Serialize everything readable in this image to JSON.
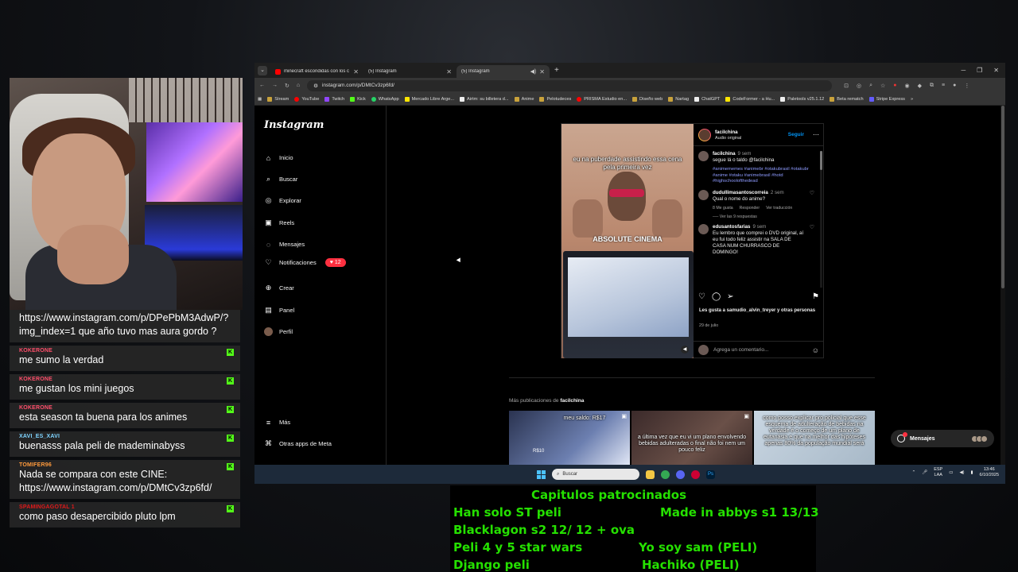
{
  "browser": {
    "tabs": [
      {
        "title": "minecraft escondidas con los c",
        "favicon": "youtube",
        "active": false
      },
      {
        "title": "(5) Instagram",
        "favicon": "instagram",
        "active": false
      },
      {
        "title": "(5) Instagram",
        "favicon": "instagram",
        "active": true
      }
    ],
    "url": "instagram.com/p/DMtCv3zp6fd/",
    "bookmarks": [
      "Stream",
      "YouTube",
      "Twitch",
      "Kick",
      "WhatsApp",
      "Mercado Libre Arge...",
      "Airtm: su billetera d...",
      "Anime",
      "Pelotudeces",
      "PRISMA Estudio en...",
      "Diseño web",
      "Nartag",
      "ChatGPT",
      "CodeFormer - a Hu...",
      "Paletools v25.1.12",
      "Beta rematch",
      "Stripe Express"
    ]
  },
  "instagram": {
    "logo": "Instagram",
    "nav": [
      {
        "label": "Inicio",
        "icon": "home-icon"
      },
      {
        "label": "Buscar",
        "icon": "search-icon"
      },
      {
        "label": "Explorar",
        "icon": "compass-icon"
      },
      {
        "label": "Reels",
        "icon": "reels-icon"
      },
      {
        "label": "Mensajes",
        "icon": "messenger-icon"
      },
      {
        "label": "Notificaciones",
        "icon": "heart-icon"
      },
      {
        "label": "Crear",
        "icon": "plus-icon"
      },
      {
        "label": "Panel",
        "icon": "chart-icon"
      },
      {
        "label": "Perfil",
        "icon": "avatar"
      }
    ],
    "notif_count": "12",
    "more": "Más",
    "meta_apps": "Otras apps de Meta",
    "post": {
      "caption_top": "eu na puberdade assistindo essa cena pela primeira vez",
      "caption_mid": "ABSOLUTE CINEMA",
      "username": "facilchina",
      "audio": "Audio original",
      "follow": "Seguir",
      "comments": [
        {
          "user": "facilchina",
          "time": "9 sem",
          "body": "segue lá o taldo @facilchina",
          "tags": "#animememes #animebr #otakubrasil #otakubr #anime #otaku #animebrasil #hotd #highschoolofthedead"
        },
        {
          "user": "dudullimasantoscorreia",
          "time": "2 sem",
          "body": "Qual o nome do anime?",
          "likes": "8 Me gusta",
          "reply": "Responder",
          "translate": "Ver traducción"
        },
        {
          "user": "edusantosfarias",
          "time": "9 sem",
          "body": "Eu lembro que comprei o DVD original, aí eu fui todo feliz assistir na SALA DE CASA NUM CHURRASCO DE DOMINGO!"
        }
      ],
      "replies": "Ver las 9 respuestas",
      "likes": "Les gusta a samudio_alvin_treyer y otras personas",
      "date": "29 de julio",
      "add_comment": "Agrega un comentario..."
    },
    "more_posts_prefix": "Más publicaciones de ",
    "more_posts_user": "facilchina",
    "thumbs": [
      {
        "text": "meu saldo: R$17",
        "sub": "R$10"
      },
      {
        "text": "a última vez que eu vi um plano envolvendo bebidas adulteradas o final não foi nem um pouco feliz",
        "sub": ""
      },
      {
        "text": "como posso explicar pro policial que esse esquema de adulteração de bebidas na verdade é o começo de um plano de eutanásia e que na melhor das hipóteses apenas 80% da população mundial será",
        "sub": ""
      }
    ],
    "messages_label": "Mensajes"
  },
  "taskbar": {
    "search": "Buscar",
    "lang": "ESP",
    "lang2": "LAA",
    "time": "13:46",
    "date": "6/10/2025"
  },
  "chat": [
    {
      "author": "",
      "color": "#ffffff",
      "text": "https://www.instagram.com/p/DPePbM3AdwP/?img_index=1 que año tuvo mas aura gordo ?"
    },
    {
      "author": "KOKERONE",
      "color": "#ff4f6b",
      "text": "me sumo la verdad"
    },
    {
      "author": "KOKERONE",
      "color": "#ff4f6b",
      "text": "me gustan los mini juegos"
    },
    {
      "author": "KOKERONE",
      "color": "#ff4f6b",
      "text": "esta season ta buena para los animes"
    },
    {
      "author": "XAVI_ES_XAVI",
      "color": "#7fd4ff",
      "text": "buenasss pala peli de mademinabyss"
    },
    {
      "author": "TOMIFER96",
      "color": "#ff9a3c",
      "text": "Nada se compara con este CINE: https://www.instagram.com/p/DMtCv3zp6fd/"
    },
    {
      "author": "SPAMINGAGOTAL 1",
      "color": "#e01a1a",
      "text": "como paso desapercibido pluto lpm"
    }
  ],
  "overlay": {
    "title": "Capitulos patrocinados",
    "items": [
      "Han solo ST peli",
      "Made in abbys s1 13/13",
      "Blacklagon s2 12/ 12 + ova",
      "Peli 4  y 5 star wars",
      "Yo soy sam (PELI)",
      "Django peli",
      "Hachiko (PELI)"
    ]
  },
  "colors": {
    "accent": "#0095f6",
    "notif": "#ff3040",
    "overlay_text": "#25e000",
    "kick": "#53fc18"
  }
}
